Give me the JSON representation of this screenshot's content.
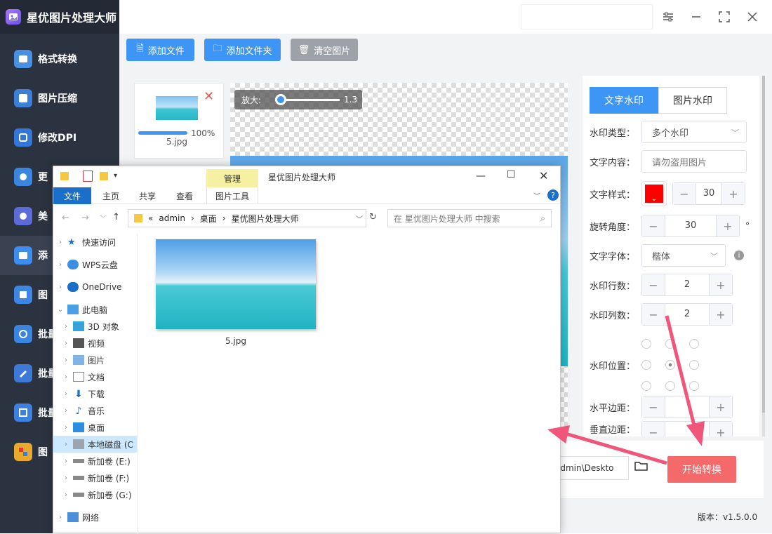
{
  "app": {
    "title": "星优图片处理大师",
    "version": "版本：v1.5.0.0"
  },
  "sidebar": {
    "items": [
      {
        "label": "格式转换"
      },
      {
        "label": "图片压缩"
      },
      {
        "label": "修改DPI"
      },
      {
        "label": "更"
      },
      {
        "label": "美"
      },
      {
        "label": "添"
      },
      {
        "label": "图"
      },
      {
        "label": "批量"
      },
      {
        "label": "批量"
      },
      {
        "label": "批量"
      },
      {
        "label": "图"
      }
    ]
  },
  "toolbar": {
    "add_file": "添加文件",
    "add_folder": "添加文件夹",
    "clear": "清空图片"
  },
  "file_card": {
    "name": "5.jpg",
    "progress": "100%"
  },
  "preview": {
    "zoom_label": "放大:",
    "zoom_value": "1.3"
  },
  "panel": {
    "tab_text": "文字水印",
    "tab_image": "图片水印",
    "type_label": "水印类型：",
    "type_value": "多个水印",
    "content_label": "文字内容：",
    "content_value": "请勿盗用图片",
    "style_label": "文字样式：",
    "style_size": "30",
    "rotate_label": "旋转角度：",
    "rotate_value": "30",
    "rotate_unit": "°",
    "font_label": "文字字体：",
    "font_value": "楷体",
    "rows_label": "水印行数：",
    "rows_value": "2",
    "cols_label": "水印列数：",
    "cols_value": "2",
    "position_label": "水印位置：",
    "hmargin_label": "水平边距：",
    "vmargin_label": "垂直边距："
  },
  "bottom": {
    "path": "admin\\Deskto",
    "start": "开始转换"
  },
  "explorer": {
    "title": "星优图片处理大师",
    "manage": "管理",
    "tabs": [
      "文件",
      "主页",
      "共享",
      "查看",
      "图片工具"
    ],
    "address": [
      "«",
      "admin",
      "桌面",
      "星优图片处理大师"
    ],
    "search_placeholder": "在 星优图片处理大师 中搜索",
    "nav": [
      "快速访问",
      "WPS云盘",
      "OneDrive",
      "此电脑",
      "3D 对象",
      "视频",
      "图片",
      "文档",
      "下载",
      "音乐",
      "桌面",
      "本地磁盘 (C",
      "新加卷 (E:)",
      "新加卷 (F:)",
      "新加卷 (G:)",
      "网络"
    ],
    "file": "5.jpg"
  },
  "colors": {
    "accent": "#3d95f6",
    "start": "#f46a6a",
    "sidebar": "#2c3340",
    "arrow": "#f0567a"
  }
}
